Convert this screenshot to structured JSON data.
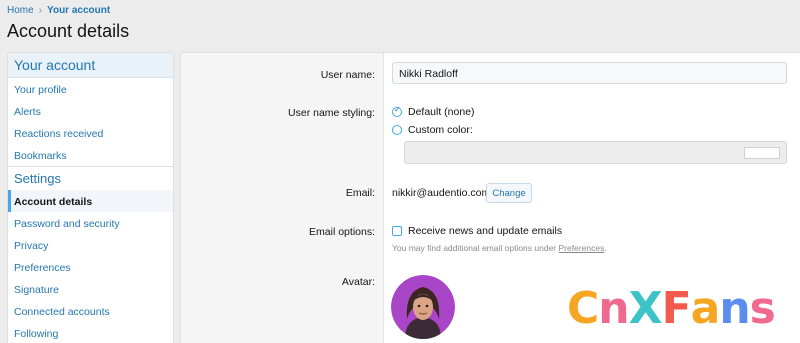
{
  "breadcrumb": {
    "home": "Home",
    "current": "Your account"
  },
  "page_title": "Account details",
  "sidebar": {
    "header": "Your account",
    "items": [
      {
        "label": "Your profile"
      },
      {
        "label": "Alerts"
      },
      {
        "label": "Reactions received"
      },
      {
        "label": "Bookmarks"
      }
    ],
    "section": "Settings",
    "settings_items": [
      {
        "label": "Account details",
        "active": true
      },
      {
        "label": "Password and security"
      },
      {
        "label": "Privacy"
      },
      {
        "label": "Preferences"
      },
      {
        "label": "Signature"
      },
      {
        "label": "Connected accounts"
      },
      {
        "label": "Following"
      }
    ]
  },
  "form": {
    "user_name_label": "User name:",
    "user_name_value": "Nikki Radloff",
    "styling_label": "User name styling:",
    "styling_default": "Default (none)",
    "styling_custom": "Custom color:",
    "email_label": "Email:",
    "email_value": "nikkir@audentio.com",
    "change_label": "Change",
    "email_options_label": "Email options:",
    "receive_news": "Receive news and update emails",
    "hint_prefix": "You may find additional email options under ",
    "hint_link": "Preferences",
    "hint_suffix": ".",
    "avatar_label": "Avatar:"
  },
  "watermark": {
    "letters": [
      "C",
      "n",
      "X",
      "F",
      "a",
      "n",
      "s"
    ],
    "colors": [
      "#f6a623",
      "#f06a8f",
      "#3cc3c8",
      "#f35a4f",
      "#f6a623",
      "#5b8def",
      "#f06a8f"
    ]
  },
  "colors": {
    "accent": "#2577b1",
    "sidebar_header_bg": "#e9f1f9"
  }
}
